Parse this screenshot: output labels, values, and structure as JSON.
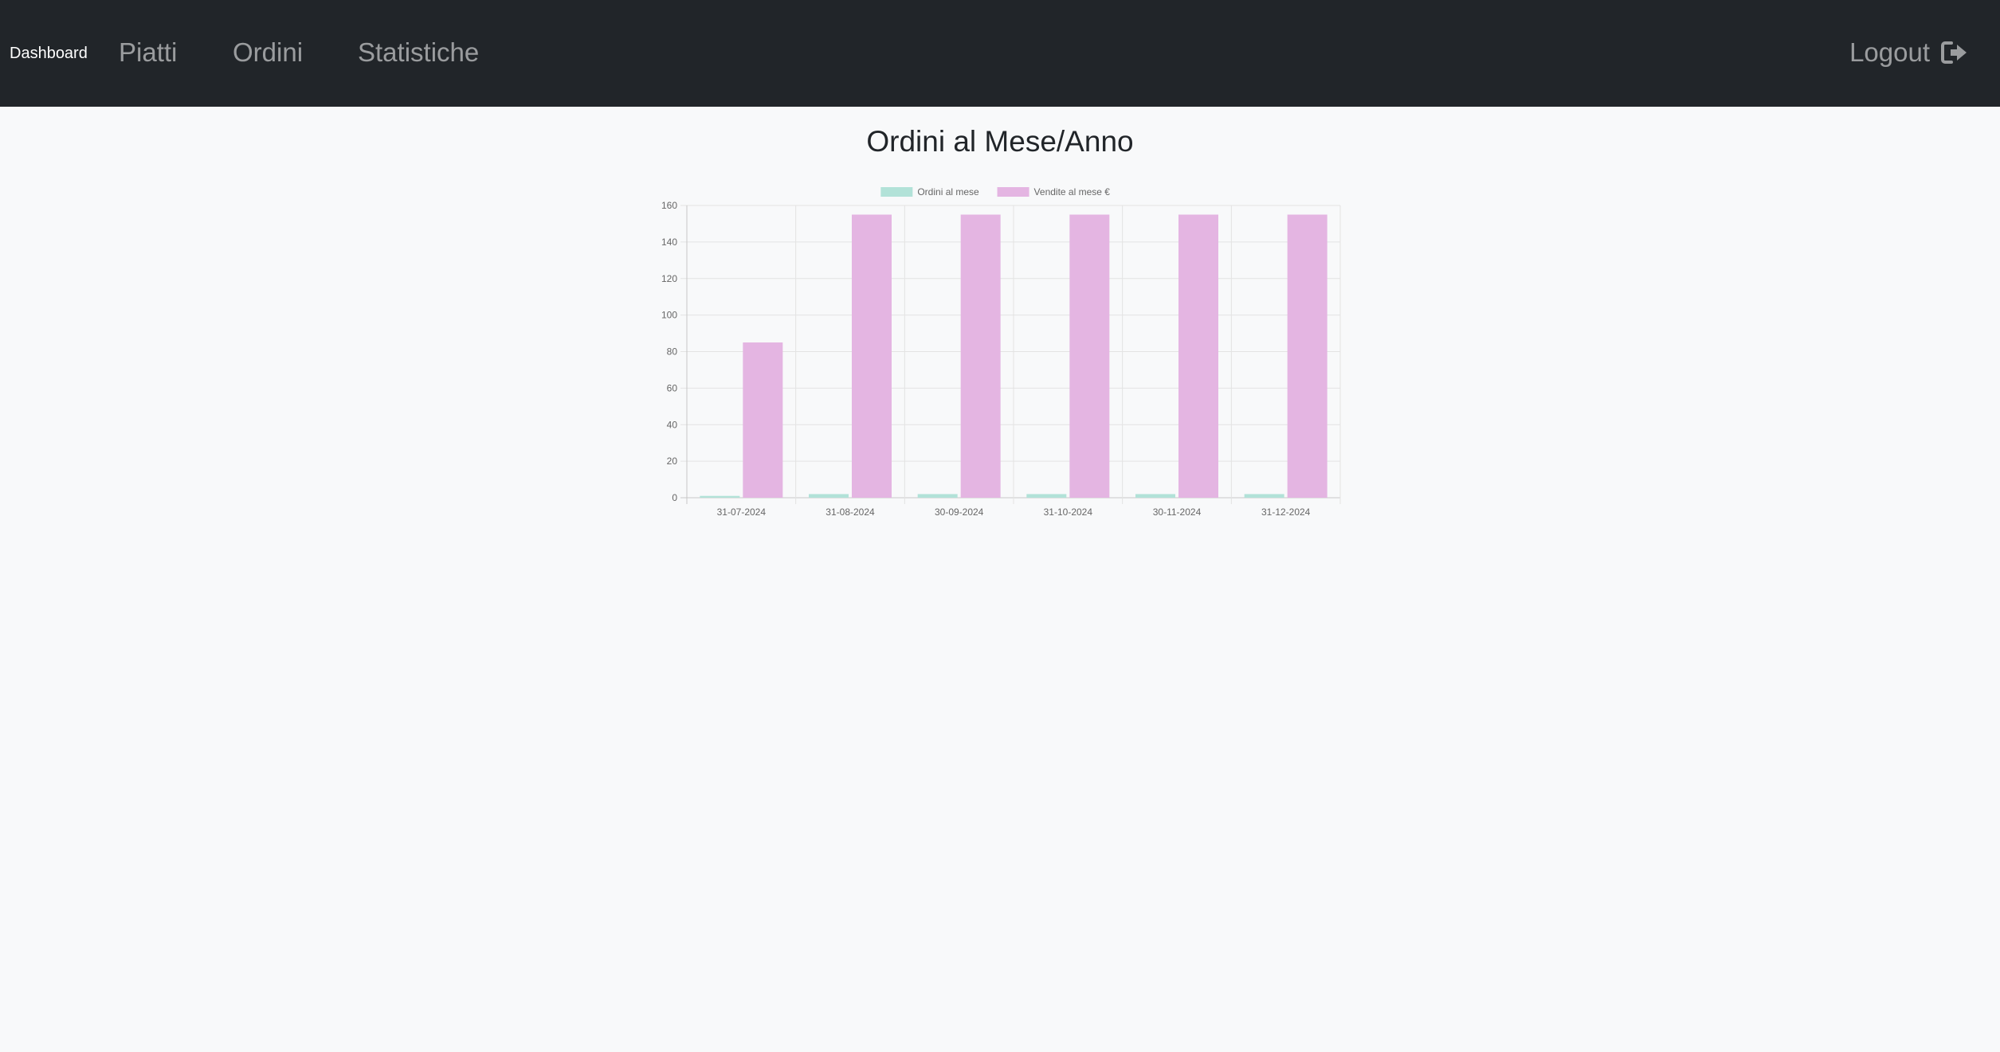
{
  "nav": {
    "brand": "Dashboard",
    "links": [
      "Piatti",
      "Ordini",
      "Statistiche"
    ],
    "logout": "Logout"
  },
  "page": {
    "title": "Ordini al Mese/Anno"
  },
  "colors": {
    "navbar_bg": "#212529",
    "series_orders": "#b2e2d8",
    "series_sales": "#e4b5e2"
  },
  "chart_data": {
    "type": "bar",
    "title": "",
    "xlabel": "",
    "ylabel": "",
    "ylim": [
      0,
      160
    ],
    "yticks": [
      0,
      20,
      40,
      60,
      80,
      100,
      120,
      140,
      160
    ],
    "categories": [
      "31-07-2024",
      "31-08-2024",
      "30-09-2024",
      "31-10-2024",
      "30-11-2024",
      "31-12-2024"
    ],
    "series": [
      {
        "name": "Ordini al mese",
        "values": [
          1,
          2,
          2,
          2,
          2,
          2
        ],
        "color": "#b2e2d8"
      },
      {
        "name": "Vendite al mese €",
        "values": [
          85,
          155,
          155,
          155,
          155,
          155
        ],
        "color": "#e4b5e2"
      }
    ],
    "legend_position": "top",
    "grid": true
  }
}
